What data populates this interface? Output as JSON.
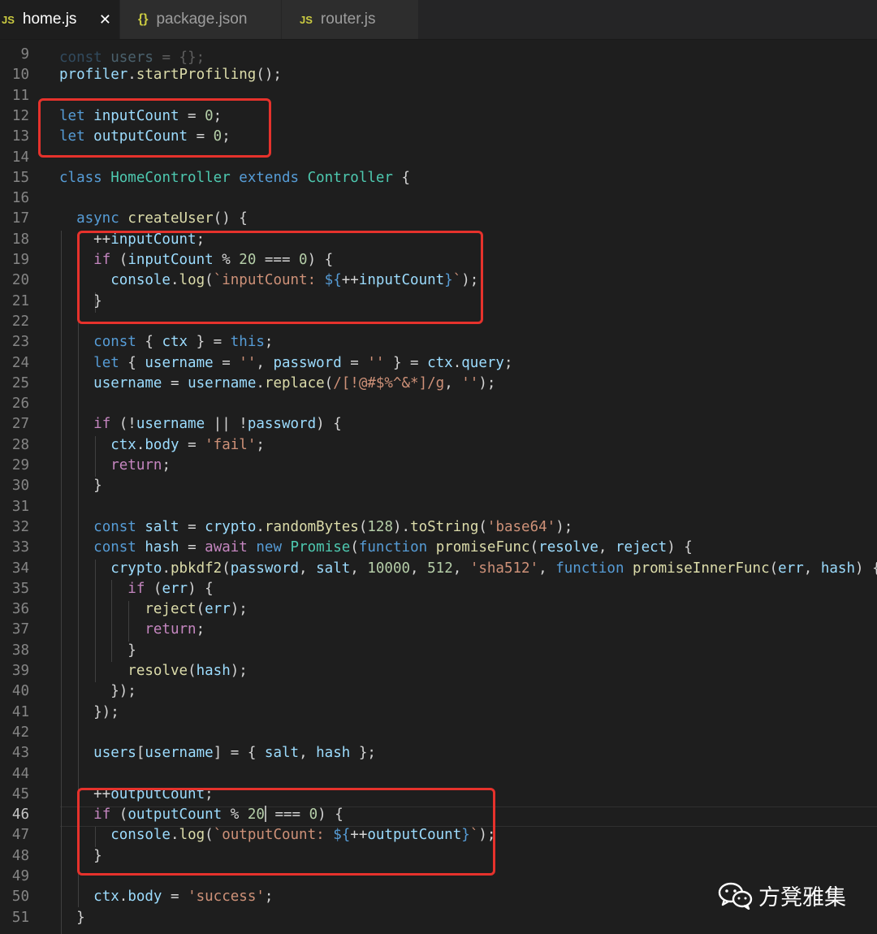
{
  "tabs": [
    {
      "icon": "JS",
      "label": "home.js",
      "active": true,
      "close": "✕"
    },
    {
      "icon": "{}",
      "label": "package.json",
      "active": false
    },
    {
      "icon": "JS",
      "label": "router.js",
      "active": false
    }
  ],
  "editor": {
    "current_line": 46,
    "highlight_color": "#e6322c",
    "lines": [
      {
        "num": "9"
      },
      {
        "num": "10"
      },
      {
        "num": "11"
      },
      {
        "num": "12"
      },
      {
        "num": "13"
      },
      {
        "num": "14"
      },
      {
        "num": "15"
      },
      {
        "num": "16"
      },
      {
        "num": "17"
      },
      {
        "num": "18"
      },
      {
        "num": "19"
      },
      {
        "num": "20"
      },
      {
        "num": "21"
      },
      {
        "num": "22"
      },
      {
        "num": "23"
      },
      {
        "num": "24"
      },
      {
        "num": "25"
      },
      {
        "num": "26"
      },
      {
        "num": "27"
      },
      {
        "num": "28"
      },
      {
        "num": "29"
      },
      {
        "num": "30"
      },
      {
        "num": "31"
      },
      {
        "num": "32"
      },
      {
        "num": "33"
      },
      {
        "num": "34"
      },
      {
        "num": "35"
      },
      {
        "num": "36"
      },
      {
        "num": "37"
      },
      {
        "num": "38"
      },
      {
        "num": "39"
      },
      {
        "num": "40"
      },
      {
        "num": "41"
      },
      {
        "num": "42"
      },
      {
        "num": "43"
      },
      {
        "num": "44"
      },
      {
        "num": "45"
      },
      {
        "num": "46"
      },
      {
        "num": "47"
      },
      {
        "num": "48"
      },
      {
        "num": "49"
      },
      {
        "num": "50"
      },
      {
        "num": "51"
      }
    ]
  },
  "watermark": {
    "text": "方凳雅集",
    "icon": "wechat-icon"
  }
}
